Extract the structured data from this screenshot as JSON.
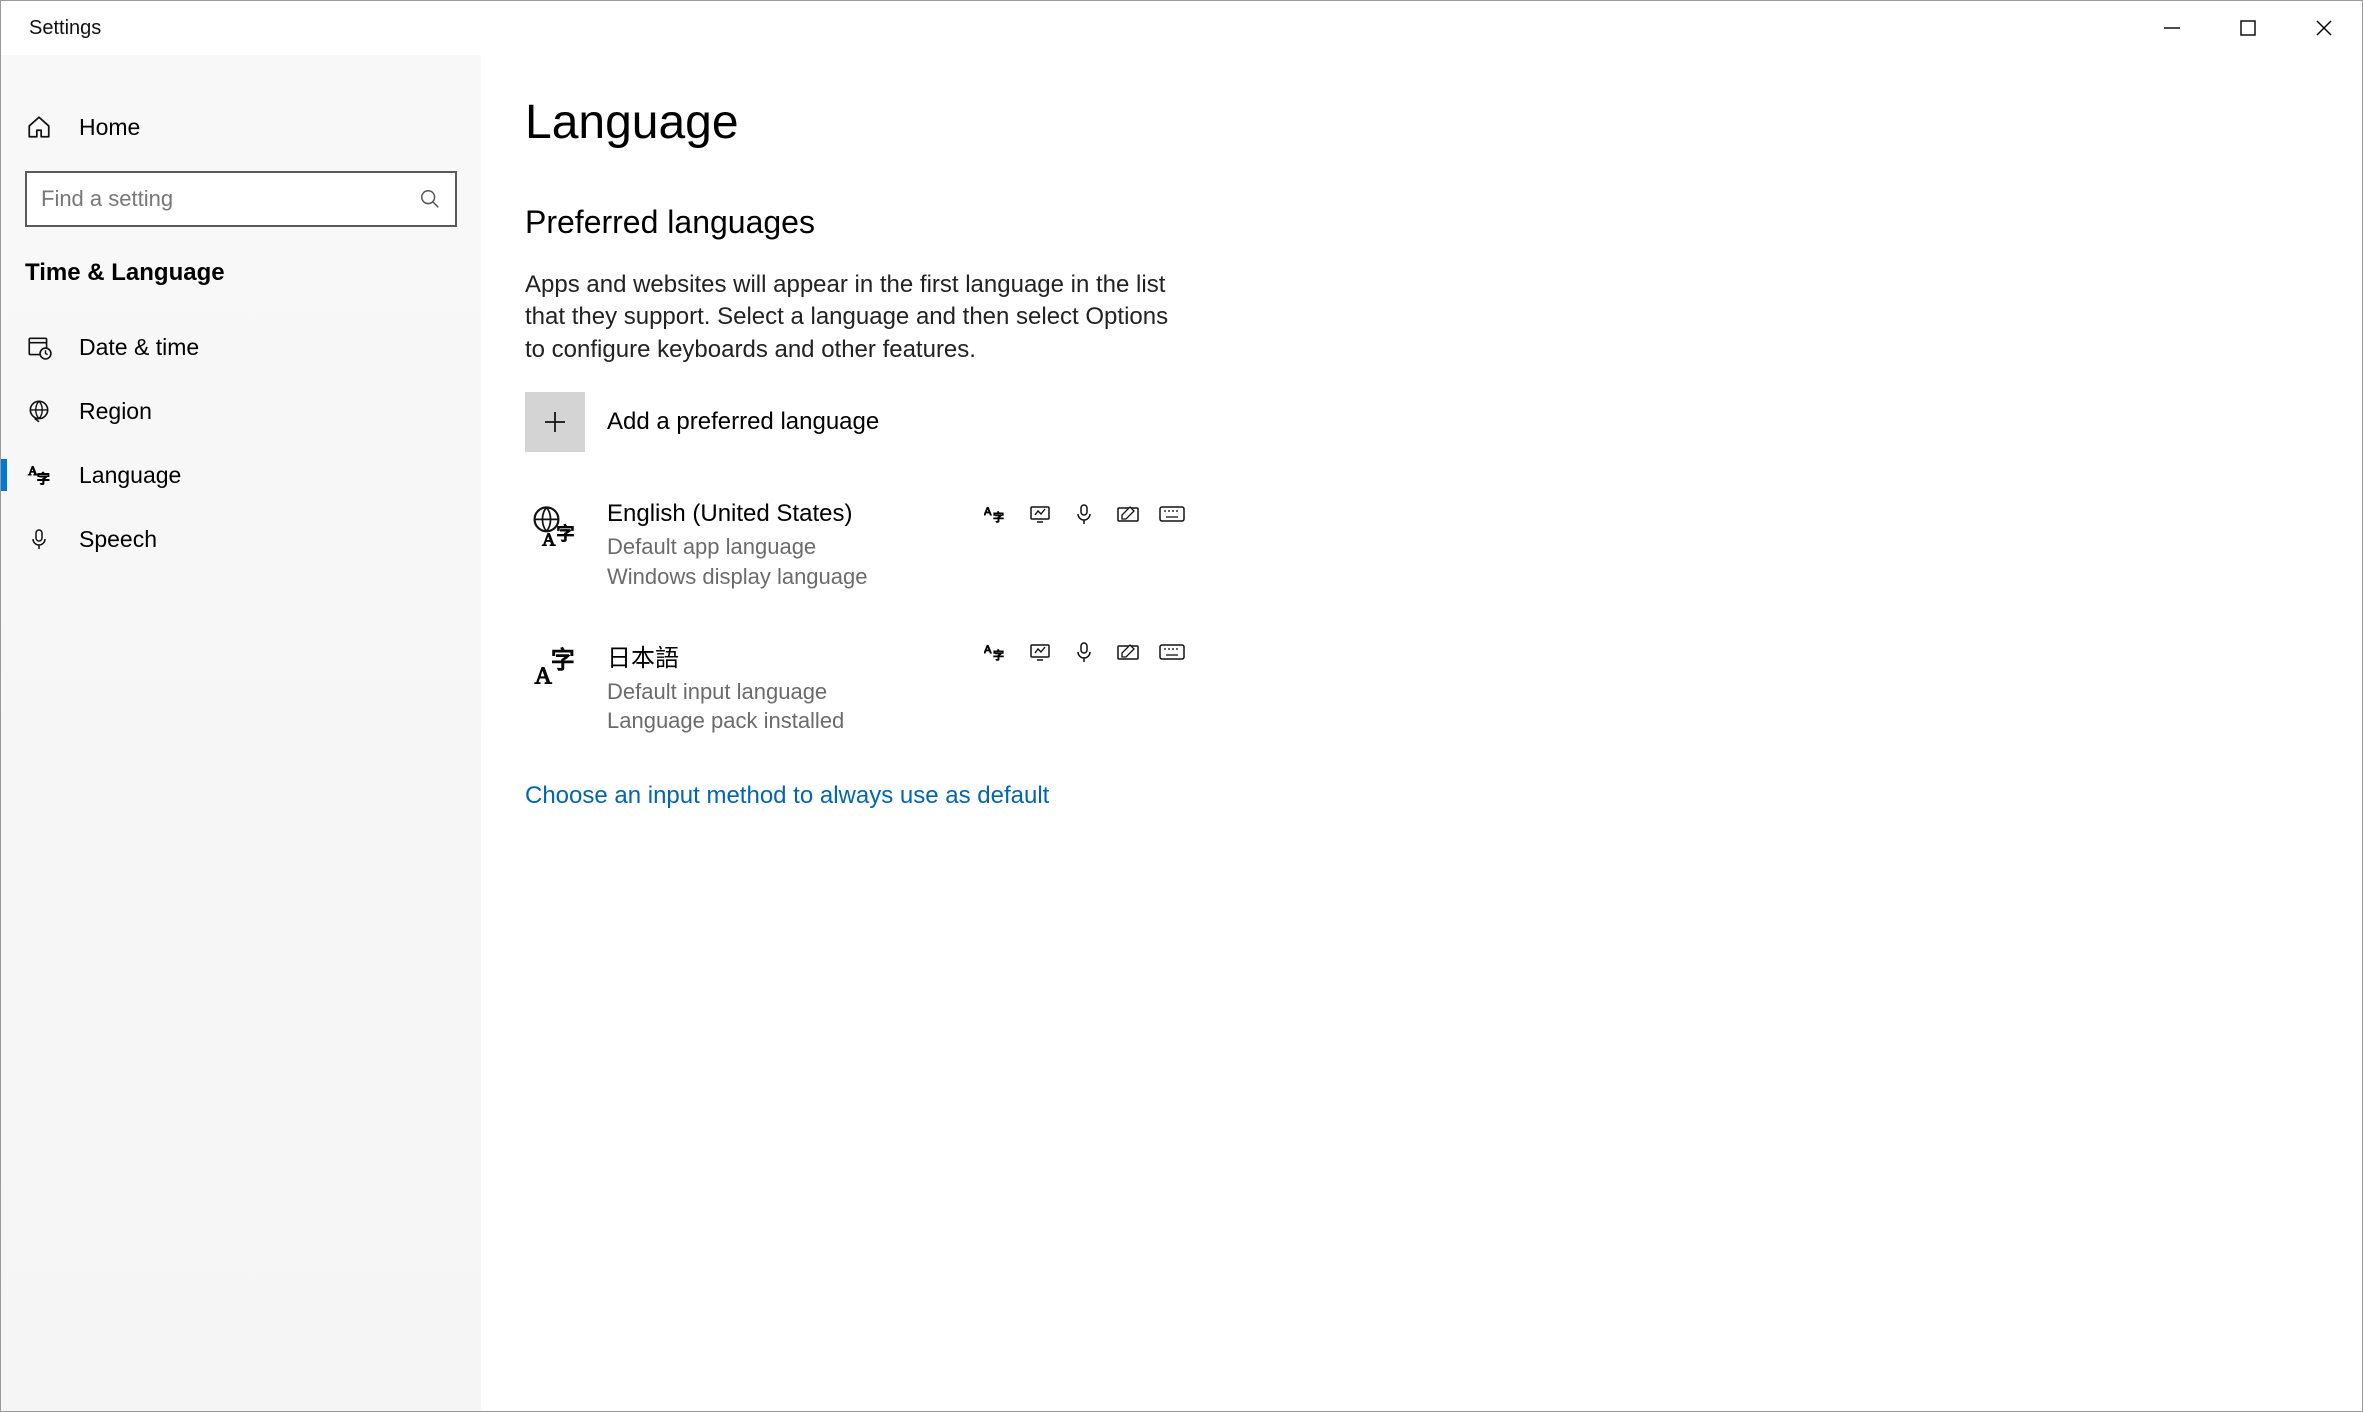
{
  "window": {
    "title": "Settings"
  },
  "sidebar": {
    "home_label": "Home",
    "search_placeholder": "Find a setting",
    "category": "Time & Language",
    "items": [
      {
        "label": "Date & time"
      },
      {
        "label": "Region"
      },
      {
        "label": "Language"
      },
      {
        "label": "Speech"
      }
    ]
  },
  "page": {
    "title": "Language",
    "section_heading": "Preferred languages",
    "section_description": "Apps and websites will appear in the first language in the list that they support. Select a language and then select Options to configure keyboards and other features.",
    "add_label": "Add a preferred language",
    "languages": [
      {
        "name": "English (United States)",
        "sub1": "Default app language",
        "sub2": "Windows display language",
        "icon": "globe",
        "features": [
          "translate",
          "display",
          "speech",
          "handwriting",
          "keyboard"
        ]
      },
      {
        "name": "日本語",
        "sub1": "Default input language",
        "sub2": "Language pack installed",
        "icon": "translate",
        "features": [
          "translate",
          "display",
          "speech",
          "handwriting",
          "keyboard"
        ]
      }
    ],
    "link": "Choose an input method to always use as default"
  }
}
